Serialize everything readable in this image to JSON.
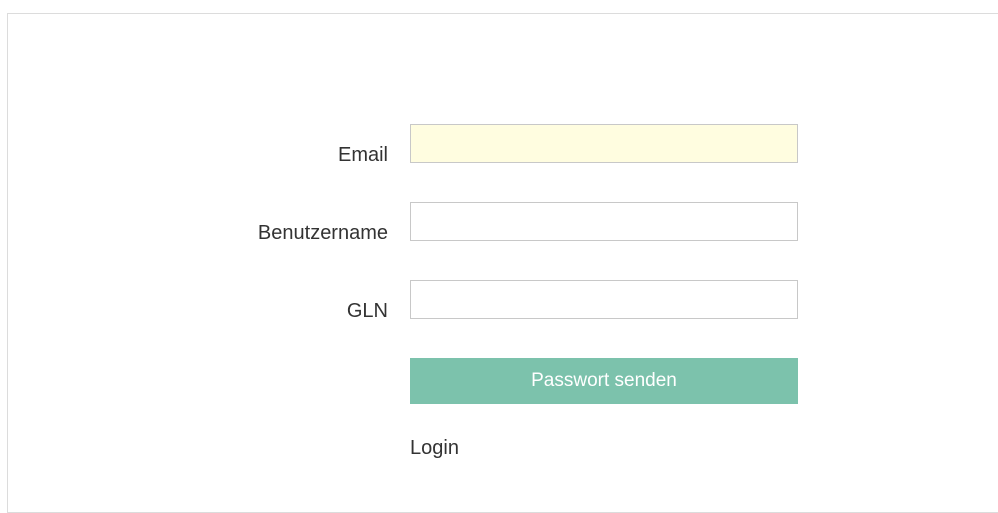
{
  "form": {
    "email": {
      "label": "Email",
      "value": "",
      "placeholder": ""
    },
    "username": {
      "label": "Benutzername",
      "value": "",
      "placeholder": ""
    },
    "gln": {
      "label": "GLN",
      "value": "",
      "placeholder": ""
    },
    "submit_label": "Passwort senden",
    "login_link": "Login"
  },
  "colors": {
    "accent": "#7cc2ac",
    "autofill_bg": "#fffde0",
    "border": "#c8c8c8"
  }
}
